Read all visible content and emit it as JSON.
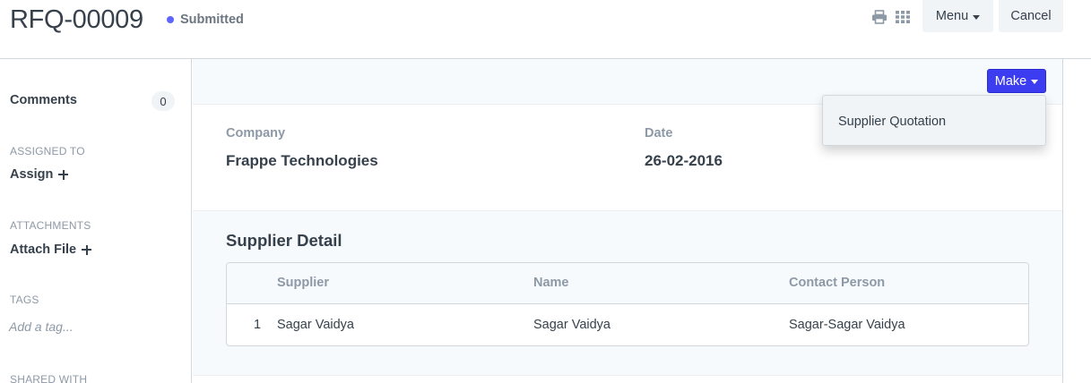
{
  "header": {
    "title": "RFQ-00009",
    "status": "Submitted",
    "status_color": "#5e64ff",
    "icons": [
      "print-icon",
      "grid-icon"
    ],
    "menu_label": "Menu",
    "cancel_label": "Cancel"
  },
  "sidebar": {
    "comments_label": "Comments",
    "comments_count": "0",
    "assigned_heading": "ASSIGNED TO",
    "assign_label": "Assign",
    "attachments_heading": "ATTACHMENTS",
    "attach_label": "Attach File",
    "tags_heading": "TAGS",
    "tag_placeholder": "Add a tag...",
    "shared_heading": "SHARED WITH"
  },
  "toolbar": {
    "make_label": "Make",
    "make_color": "#3c3cf0"
  },
  "dropdown": {
    "items": [
      {
        "label": "Supplier Quotation"
      }
    ]
  },
  "form": {
    "company_label": "Company",
    "company_value": "Frappe Technologies",
    "date_label": "Date",
    "date_value": "26-02-2016"
  },
  "supplier_detail": {
    "title": "Supplier Detail",
    "columns": [
      "Supplier",
      "Name",
      "Contact Person"
    ],
    "rows": [
      {
        "idx": "1",
        "supplier": "Sagar Vaidya",
        "name": "Sagar Vaidya",
        "contact_person": "Sagar-Sagar Vaidya"
      }
    ]
  }
}
